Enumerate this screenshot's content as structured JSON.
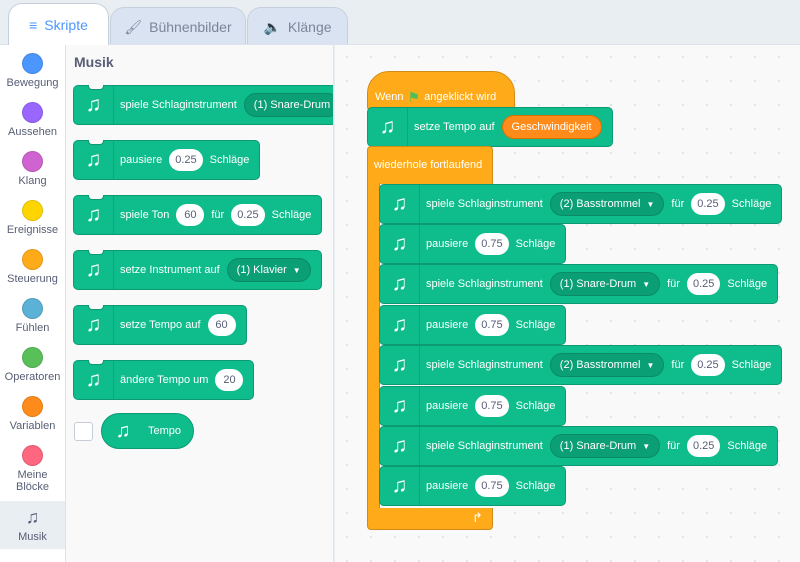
{
  "tabs": [
    {
      "label": "Skripte",
      "icon": "code-icon"
    },
    {
      "label": "Bühnenbilder",
      "icon": "brush-icon"
    },
    {
      "label": "Klänge",
      "icon": "speaker-icon"
    }
  ],
  "categories": [
    {
      "label": "Bewegung",
      "color": "#4c97ff"
    },
    {
      "label": "Aussehen",
      "color": "#9966ff"
    },
    {
      "label": "Klang",
      "color": "#cf63cf"
    },
    {
      "label": "Ereignisse",
      "color": "#ffd500"
    },
    {
      "label": "Steuerung",
      "color": "#ffab19"
    },
    {
      "label": "Fühlen",
      "color": "#5cb1d6"
    },
    {
      "label": "Operatoren",
      "color": "#59c059"
    },
    {
      "label": "Variablen",
      "color": "#ff8c1a"
    },
    {
      "label": "Meine Blöcke",
      "color": "#ff6680"
    },
    {
      "label": "Musik",
      "color": "#0fbd8c"
    }
  ],
  "palette": {
    "title": "Musik",
    "blocks": {
      "b1": {
        "text": "spiele Schlaginstrument",
        "drop": "(1) Snare-Drum"
      },
      "b2": {
        "text": "pausiere",
        "num": "0.25",
        "suffix": "Schläge"
      },
      "b3": {
        "text": "spiele Ton",
        "num1": "60",
        "mid": "für",
        "num2": "0.25",
        "suffix": "Schläge"
      },
      "b4": {
        "text": "setze Instrument auf",
        "drop": "(1) Klavier"
      },
      "b5": {
        "text": "setze Tempo auf",
        "num": "60"
      },
      "b6": {
        "text": "ändere Tempo um",
        "num": "20"
      },
      "b7": {
        "text": "Tempo"
      }
    }
  },
  "script": {
    "hat": {
      "pre": "Wenn",
      "post": "angeklickt wird"
    },
    "set_tempo": {
      "text": "setze Tempo auf",
      "reporter": "Geschwindigkeit"
    },
    "loop_label": "wiederhole fortlaufend",
    "b1": {
      "text": "spiele Schlaginstrument",
      "drop": "(2) Basstrommel",
      "mid": "für",
      "num": "0.25",
      "suffix": "Schläge"
    },
    "b2": {
      "text": "pausiere",
      "num": "0.75",
      "suffix": "Schläge"
    },
    "b3": {
      "text": "spiele Schlaginstrument",
      "drop": "(1) Snare-Drum",
      "mid": "für",
      "num": "0.25",
      "suffix": "Schläge"
    },
    "b4": {
      "text": "pausiere",
      "num": "0.75",
      "suffix": "Schläge"
    },
    "b5": {
      "text": "spiele Schlaginstrument",
      "drop": "(2) Basstrommel",
      "mid": "für",
      "num": "0.25",
      "suffix": "Schläge"
    },
    "b6": {
      "text": "pausiere",
      "num": "0.75",
      "suffix": "Schläge"
    },
    "b7": {
      "text": "spiele Schlaginstrument",
      "drop": "(1) Snare-Drum",
      "mid": "für",
      "num": "0.25",
      "suffix": "Schläge"
    },
    "b8": {
      "text": "pausiere",
      "num": "0.75",
      "suffix": "Schläge"
    }
  }
}
